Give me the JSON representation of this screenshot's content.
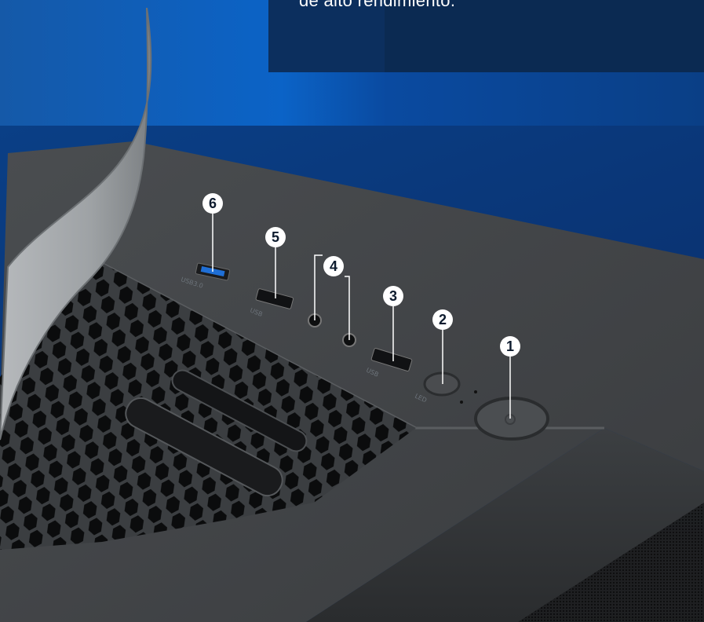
{
  "caption": {
    "text": "de alto rendimiento."
  },
  "callouts": [
    {
      "number": "1",
      "label": "power-button"
    },
    {
      "number": "2",
      "label": "led-button"
    },
    {
      "number": "3",
      "label": "usb-port"
    },
    {
      "number": "4",
      "label": "audio-jacks"
    },
    {
      "number": "5",
      "label": "usb-port"
    },
    {
      "number": "6",
      "label": "usb3-port"
    }
  ],
  "port_labels": {
    "usb3": "USB3.0",
    "usb_a": "USB",
    "usb_b": "USB",
    "led": "LED"
  },
  "colors": {
    "background": "#0a3f86",
    "caption_box": "#0c2f5e",
    "case": "#3a3d40",
    "usb3_accent": "#1f6fd6"
  }
}
